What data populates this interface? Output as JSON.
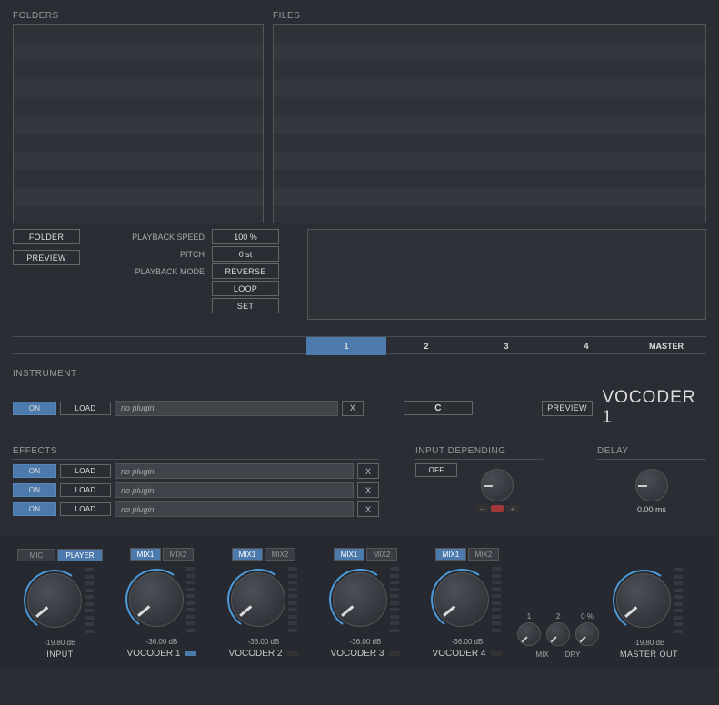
{
  "browser": {
    "folders_label": "FOLDERS",
    "files_label": "FILES",
    "folder_btn": "FOLDER",
    "preview_btn": "PREVIEW"
  },
  "playback": {
    "speed_label": "PLAYBACK SPEED",
    "speed_value": "100 %",
    "pitch_label": "PITCH",
    "pitch_value": "0 st",
    "mode_label": "PLAYBACK  MODE",
    "reverse": "REVERSE",
    "loop": "LOOP",
    "set": "SET"
  },
  "tabs": {
    "t1": "1",
    "t2": "2",
    "t3": "3",
    "t4": "4",
    "master": "MASTER"
  },
  "instrument": {
    "label": "INSTRUMENT",
    "on": "ON",
    "load": "LOAD",
    "plugin": "no plugin",
    "x": "X",
    "key": "C",
    "preview": "PREVIEW",
    "title": "VOCODER 1"
  },
  "effects": {
    "label": "EFFECTS",
    "rows": [
      {
        "on": "ON",
        "load": "LOAD",
        "plugin": "no plugin",
        "x": "X"
      },
      {
        "on": "ON",
        "load": "LOAD",
        "plugin": "no plugin",
        "x": "X"
      },
      {
        "on": "ON",
        "load": "LOAD",
        "plugin": "no plugin",
        "x": "X"
      }
    ],
    "input_depending_label": "INPUT DEPENDING",
    "input_depending_value": "OFF",
    "minus": "−",
    "plus": "+",
    "delay_label": "DELAY",
    "delay_value": "0.00 ms"
  },
  "mixer": {
    "mic": "MIC",
    "player": "PLAYER",
    "mix1": "MIX1",
    "mix2": "MIX2",
    "input_val": "-19.80 dB",
    "input_label": "INPUT",
    "voc_val": "-36.00 dB",
    "v1": "VOCODER 1",
    "v2": "VOCODER 2",
    "v3": "VOCODER 3",
    "v4": "VOCODER 4",
    "mix_num1": "1",
    "mix_num2": "2",
    "mix_label": "MIX",
    "dry_val": "0 %",
    "dry_label": "DRY",
    "master_val": "-19.80 dB",
    "master_label": "MASTER OUT"
  }
}
